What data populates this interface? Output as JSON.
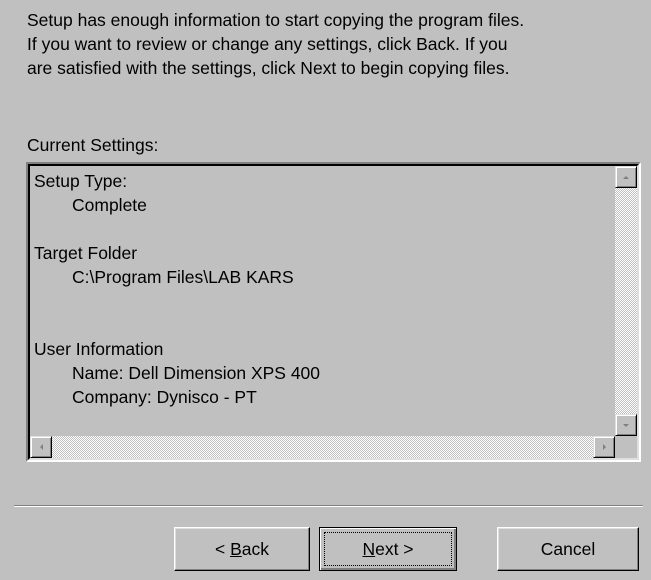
{
  "intro": {
    "line1": "Setup has enough information to start copying the program files.",
    "line2": "If you want to review or change any settings, click Back.  If you",
    "line3": "are satisfied with the settings, click Next to begin copying files."
  },
  "current_settings_label": "Current Settings:",
  "settings": {
    "setup_type_label": "Setup Type:",
    "setup_type_value": "Complete",
    "target_folder_label": "Target Folder",
    "target_folder_value": "C:\\Program Files\\LAB KARS",
    "user_info_label": "User Information",
    "name_line": "Name:  Dell Dimension XPS 400",
    "company_line": "Company:  Dynisco - PT"
  },
  "buttons": {
    "back_prefix": "< ",
    "back_accel": "B",
    "back_rest": "ack",
    "next_accel": "N",
    "next_rest": "ext >",
    "cancel": "Cancel"
  }
}
